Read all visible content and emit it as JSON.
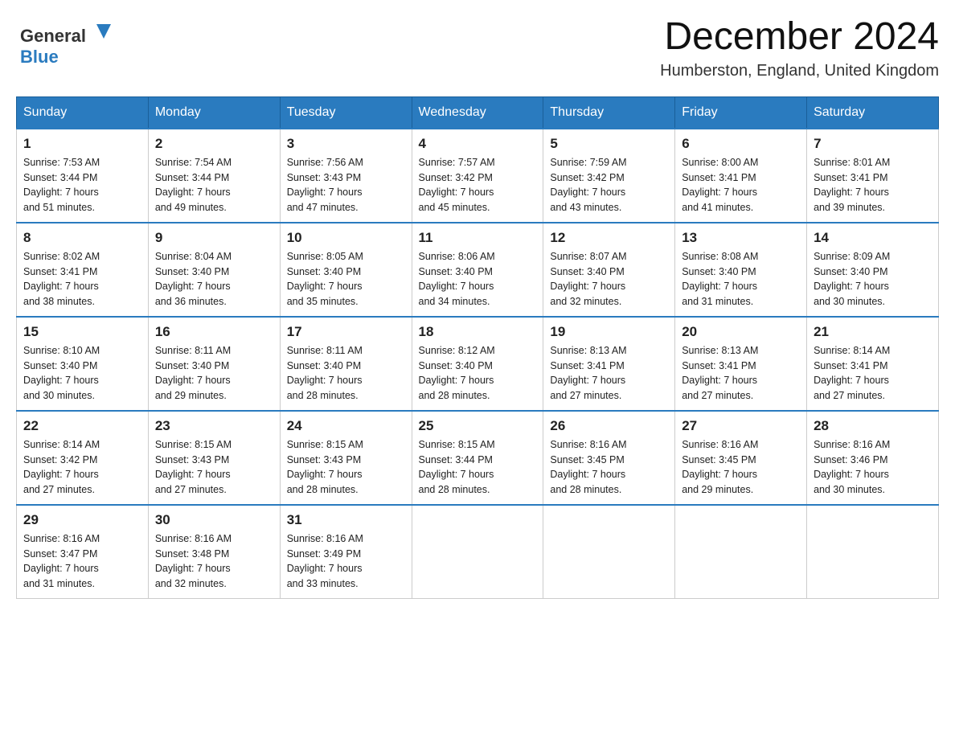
{
  "header": {
    "logo_text_general": "General",
    "logo_text_blue": "Blue",
    "month_year": "December 2024",
    "location": "Humberston, England, United Kingdom"
  },
  "weekdays": [
    "Sunday",
    "Monday",
    "Tuesday",
    "Wednesday",
    "Thursday",
    "Friday",
    "Saturday"
  ],
  "weeks": [
    [
      {
        "day": "1",
        "sunrise": "7:53 AM",
        "sunset": "3:44 PM",
        "daylight": "7 hours and 51 minutes."
      },
      {
        "day": "2",
        "sunrise": "7:54 AM",
        "sunset": "3:44 PM",
        "daylight": "7 hours and 49 minutes."
      },
      {
        "day": "3",
        "sunrise": "7:56 AM",
        "sunset": "3:43 PM",
        "daylight": "7 hours and 47 minutes."
      },
      {
        "day": "4",
        "sunrise": "7:57 AM",
        "sunset": "3:42 PM",
        "daylight": "7 hours and 45 minutes."
      },
      {
        "day": "5",
        "sunrise": "7:59 AM",
        "sunset": "3:42 PM",
        "daylight": "7 hours and 43 minutes."
      },
      {
        "day": "6",
        "sunrise": "8:00 AM",
        "sunset": "3:41 PM",
        "daylight": "7 hours and 41 minutes."
      },
      {
        "day": "7",
        "sunrise": "8:01 AM",
        "sunset": "3:41 PM",
        "daylight": "7 hours and 39 minutes."
      }
    ],
    [
      {
        "day": "8",
        "sunrise": "8:02 AM",
        "sunset": "3:41 PM",
        "daylight": "7 hours and 38 minutes."
      },
      {
        "day": "9",
        "sunrise": "8:04 AM",
        "sunset": "3:40 PM",
        "daylight": "7 hours and 36 minutes."
      },
      {
        "day": "10",
        "sunrise": "8:05 AM",
        "sunset": "3:40 PM",
        "daylight": "7 hours and 35 minutes."
      },
      {
        "day": "11",
        "sunrise": "8:06 AM",
        "sunset": "3:40 PM",
        "daylight": "7 hours and 34 minutes."
      },
      {
        "day": "12",
        "sunrise": "8:07 AM",
        "sunset": "3:40 PM",
        "daylight": "7 hours and 32 minutes."
      },
      {
        "day": "13",
        "sunrise": "8:08 AM",
        "sunset": "3:40 PM",
        "daylight": "7 hours and 31 minutes."
      },
      {
        "day": "14",
        "sunrise": "8:09 AM",
        "sunset": "3:40 PM",
        "daylight": "7 hours and 30 minutes."
      }
    ],
    [
      {
        "day": "15",
        "sunrise": "8:10 AM",
        "sunset": "3:40 PM",
        "daylight": "7 hours and 30 minutes."
      },
      {
        "day": "16",
        "sunrise": "8:11 AM",
        "sunset": "3:40 PM",
        "daylight": "7 hours and 29 minutes."
      },
      {
        "day": "17",
        "sunrise": "8:11 AM",
        "sunset": "3:40 PM",
        "daylight": "7 hours and 28 minutes."
      },
      {
        "day": "18",
        "sunrise": "8:12 AM",
        "sunset": "3:40 PM",
        "daylight": "7 hours and 28 minutes."
      },
      {
        "day": "19",
        "sunrise": "8:13 AM",
        "sunset": "3:41 PM",
        "daylight": "7 hours and 27 minutes."
      },
      {
        "day": "20",
        "sunrise": "8:13 AM",
        "sunset": "3:41 PM",
        "daylight": "7 hours and 27 minutes."
      },
      {
        "day": "21",
        "sunrise": "8:14 AM",
        "sunset": "3:41 PM",
        "daylight": "7 hours and 27 minutes."
      }
    ],
    [
      {
        "day": "22",
        "sunrise": "8:14 AM",
        "sunset": "3:42 PM",
        "daylight": "7 hours and 27 minutes."
      },
      {
        "day": "23",
        "sunrise": "8:15 AM",
        "sunset": "3:43 PM",
        "daylight": "7 hours and 27 minutes."
      },
      {
        "day": "24",
        "sunrise": "8:15 AM",
        "sunset": "3:43 PM",
        "daylight": "7 hours and 28 minutes."
      },
      {
        "day": "25",
        "sunrise": "8:15 AM",
        "sunset": "3:44 PM",
        "daylight": "7 hours and 28 minutes."
      },
      {
        "day": "26",
        "sunrise": "8:16 AM",
        "sunset": "3:45 PM",
        "daylight": "7 hours and 28 minutes."
      },
      {
        "day": "27",
        "sunrise": "8:16 AM",
        "sunset": "3:45 PM",
        "daylight": "7 hours and 29 minutes."
      },
      {
        "day": "28",
        "sunrise": "8:16 AM",
        "sunset": "3:46 PM",
        "daylight": "7 hours and 30 minutes."
      }
    ],
    [
      {
        "day": "29",
        "sunrise": "8:16 AM",
        "sunset": "3:47 PM",
        "daylight": "7 hours and 31 minutes."
      },
      {
        "day": "30",
        "sunrise": "8:16 AM",
        "sunset": "3:48 PM",
        "daylight": "7 hours and 32 minutes."
      },
      {
        "day": "31",
        "sunrise": "8:16 AM",
        "sunset": "3:49 PM",
        "daylight": "7 hours and 33 minutes."
      },
      null,
      null,
      null,
      null
    ]
  ],
  "labels": {
    "sunrise": "Sunrise:",
    "sunset": "Sunset:",
    "daylight": "Daylight:"
  }
}
